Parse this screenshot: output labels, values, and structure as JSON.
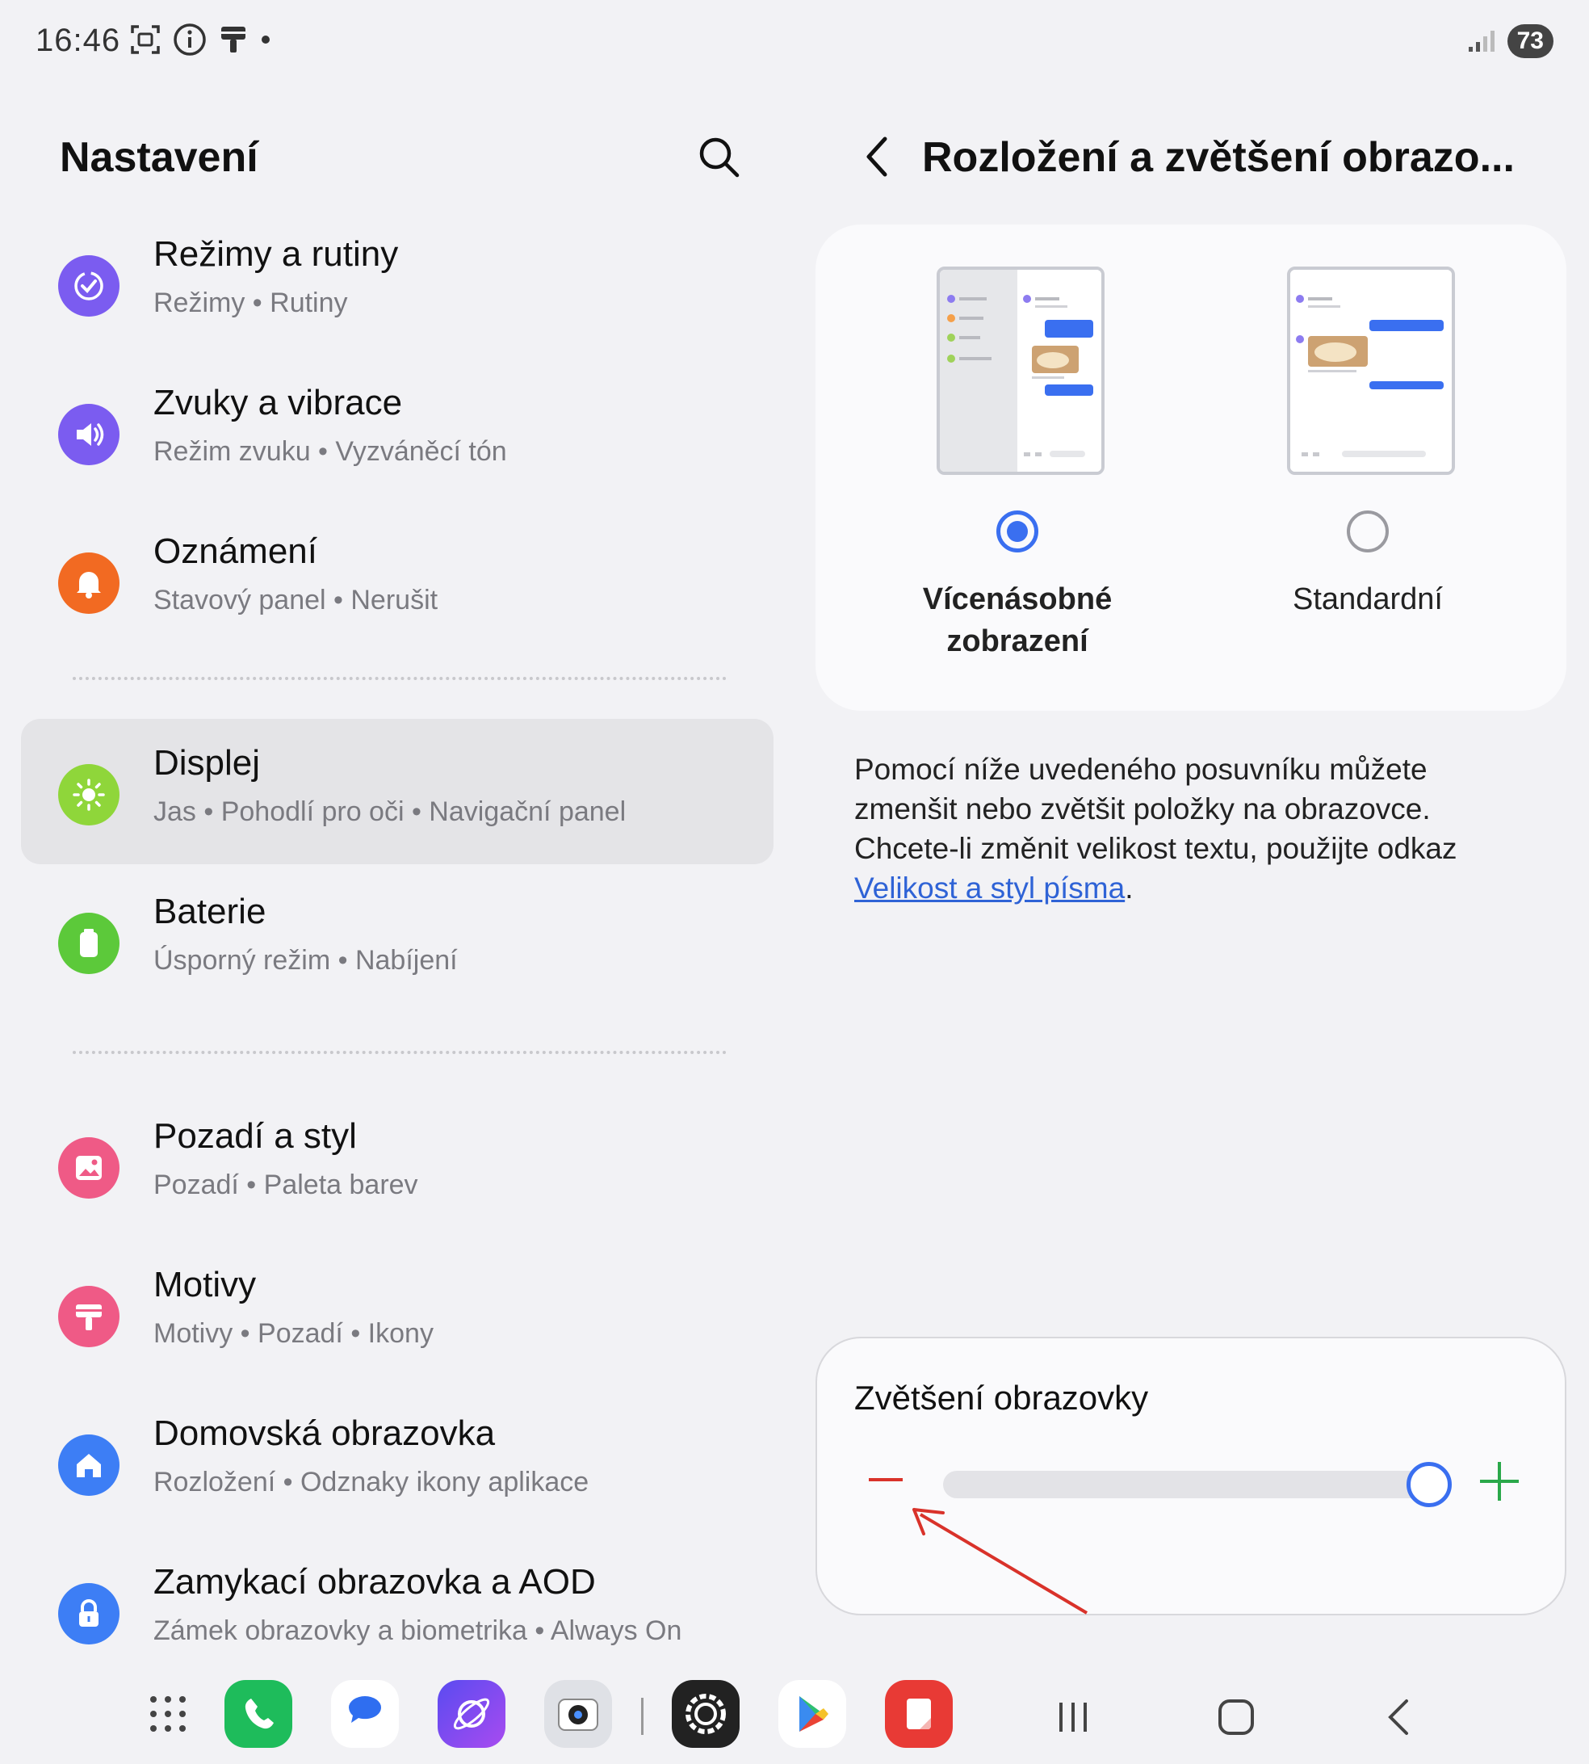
{
  "status_bar": {
    "time": "16:46",
    "battery": "73"
  },
  "left": {
    "title": "Nastavení",
    "items": [
      {
        "title": "Režimy a rutiny",
        "subtitle": "Režimy  •  Rutiny",
        "icon": "modes-icon",
        "color": "#7b5cf0"
      },
      {
        "title": "Zvuky a vibrace",
        "subtitle": "Režim zvuku  •  Vyzváněcí tón",
        "icon": "sound-icon",
        "color": "#7b5cf0"
      },
      {
        "title": "Oznámení",
        "subtitle": "Stavový panel  •  Nerušit",
        "icon": "bell-icon",
        "color": "#f26a22"
      },
      {
        "title": "Displej",
        "subtitle": "Jas  •  Pohodlí pro oči  •  Navigační panel",
        "icon": "sun-icon",
        "color": "#8fd63a"
      },
      {
        "title": "Baterie",
        "subtitle": "Úsporný režim  •  Nabíjení",
        "icon": "battery-icon",
        "color": "#5cc93a"
      },
      {
        "title": "Pozadí a styl",
        "subtitle": "Pozadí  •  Paleta barev",
        "icon": "wallpaper-icon",
        "color": "#ef5a86"
      },
      {
        "title": "Motivy",
        "subtitle": "Motivy  •  Pozadí  •  Ikony",
        "icon": "themes-icon",
        "color": "#ef5a86"
      },
      {
        "title": "Domovská obrazovka",
        "subtitle": "Rozložení  •  Odznaky ikony aplikace",
        "icon": "home-icon",
        "color": "#3d7ef5"
      },
      {
        "title": "Zamykací obrazovka a AOD",
        "subtitle": "Zámek obrazovky a biometrika  •  Always On",
        "icon": "lock-icon",
        "color": "#3d7ef5"
      }
    ]
  },
  "right": {
    "title": "Rozložení a zvětšení obrazo...",
    "options": [
      {
        "label_line1": "Vícenásobné",
        "label_line2": "zobrazení",
        "selected": true
      },
      {
        "label_line1": "Standardní",
        "label_line2": "",
        "selected": false
      }
    ],
    "description": "Pomocí níže uvedeného posuvníku můžete zmenšit nebo zvětšit položky na obrazovce. Chcete-li změnit velikost textu, použijte odkaz ",
    "link_text": "Velikost a styl písma",
    "link_suffix": ".",
    "zoom": {
      "title": "Zvětšení obrazovky",
      "level": 1.0
    }
  },
  "colors": {
    "accent": "#3a6ff0",
    "minus": "#d9322a",
    "plus": "#2aa84a"
  },
  "dock": {
    "apps": [
      "apps-grid-icon",
      "phone-icon",
      "messages-icon",
      "internet-icon",
      "camera-icon",
      "settings-icon",
      "play-store-icon",
      "notes-icon"
    ],
    "nav": [
      "recents-icon",
      "home-nav-icon",
      "back-nav-icon"
    ]
  }
}
